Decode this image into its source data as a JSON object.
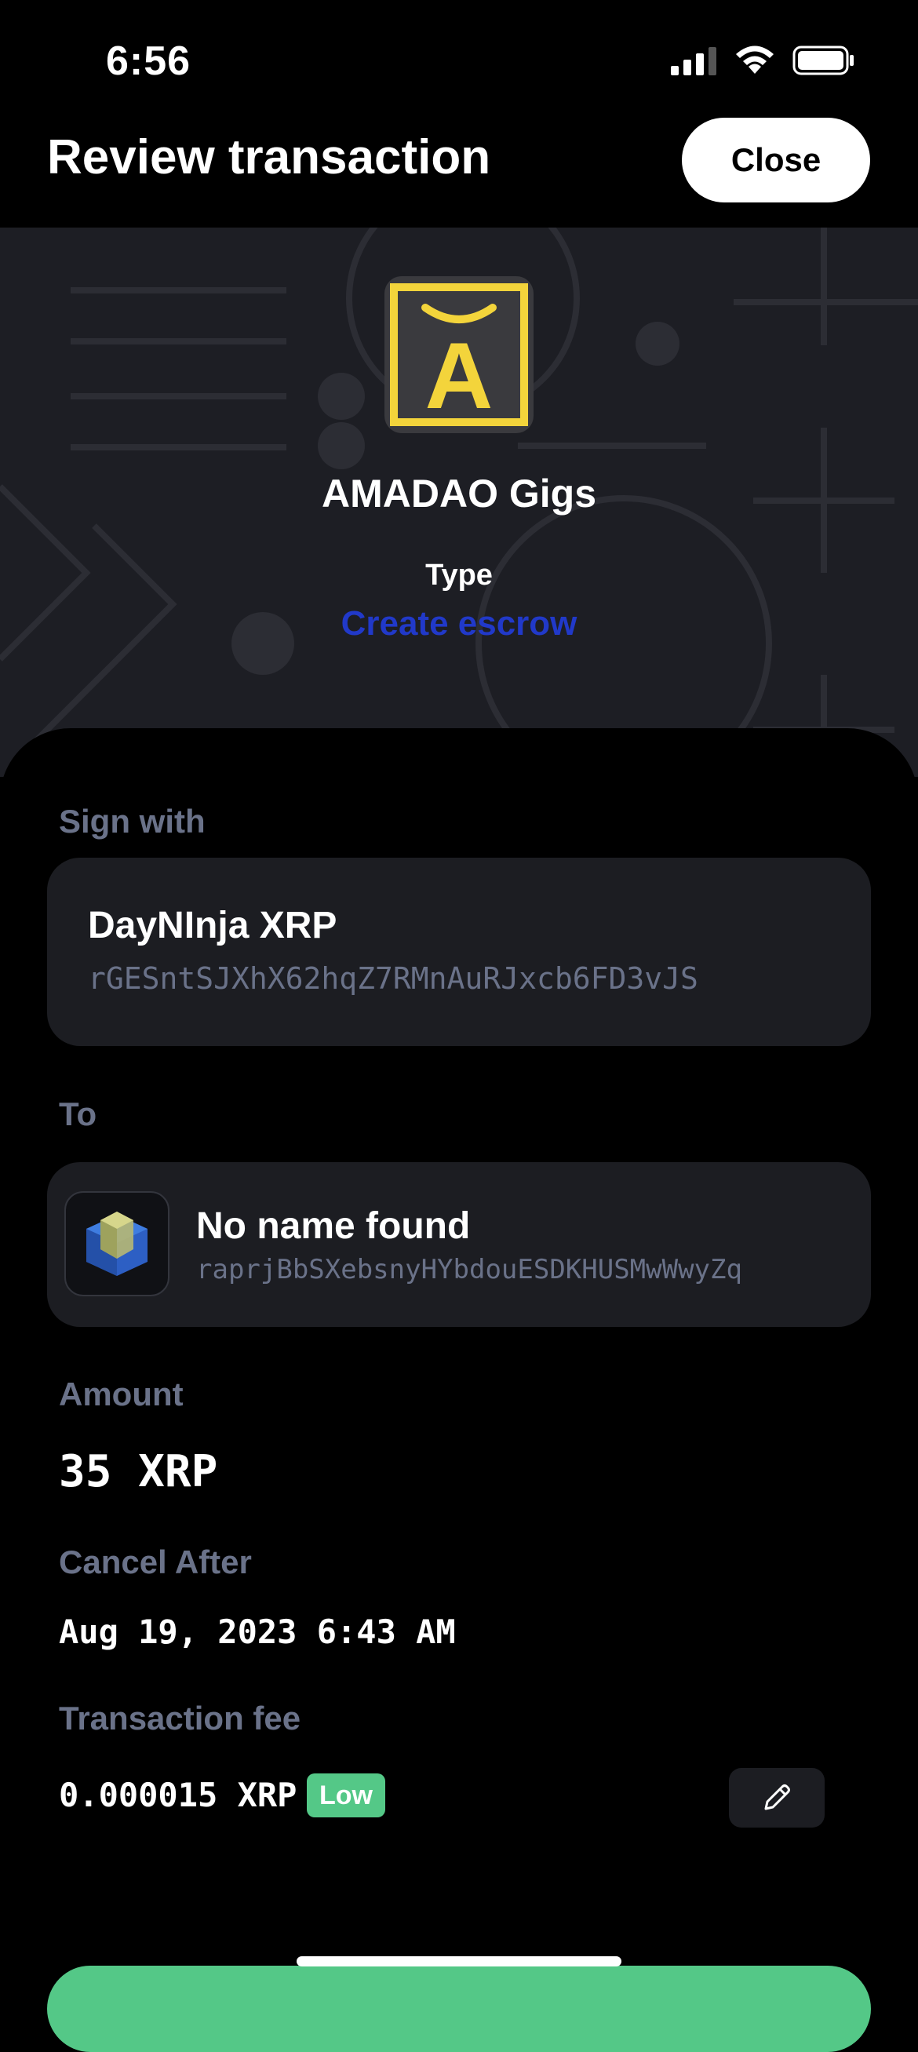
{
  "status_bar": {
    "time": "6:56",
    "icons": [
      "signal-icon",
      "wifi-icon",
      "battery-icon"
    ]
  },
  "header": {
    "title": "Review transaction",
    "close_label": "Close"
  },
  "request": {
    "app_name": "AMADAO Gigs",
    "logo_letter": "A",
    "type_label": "Type",
    "type_value": "Create escrow"
  },
  "sign_with": {
    "label": "Sign with",
    "account_name": "DayNInja XRP",
    "account_address": "rGESntSJXhX62hqZ7RMnAuRJxcb6FD3vJS"
  },
  "to": {
    "label": "To",
    "name": "No name found",
    "address": "raprjBbSXebsnyHYbdouESDKHUSMwWwyZq"
  },
  "amount": {
    "label": "Amount",
    "value": "35 XRP"
  },
  "cancel_after": {
    "label": "Cancel After",
    "value": "Aug 19, 2023 6:43 AM"
  },
  "transaction_fee": {
    "label": "Transaction fee",
    "value": "0.000015 XRP",
    "level": "Low"
  },
  "colors": {
    "accent_blue": "#2139c9",
    "success_green": "#54c887",
    "muted_label": "#6a7289",
    "card_bg": "#1c1d22",
    "logo_yellow": "#f3d43b"
  }
}
